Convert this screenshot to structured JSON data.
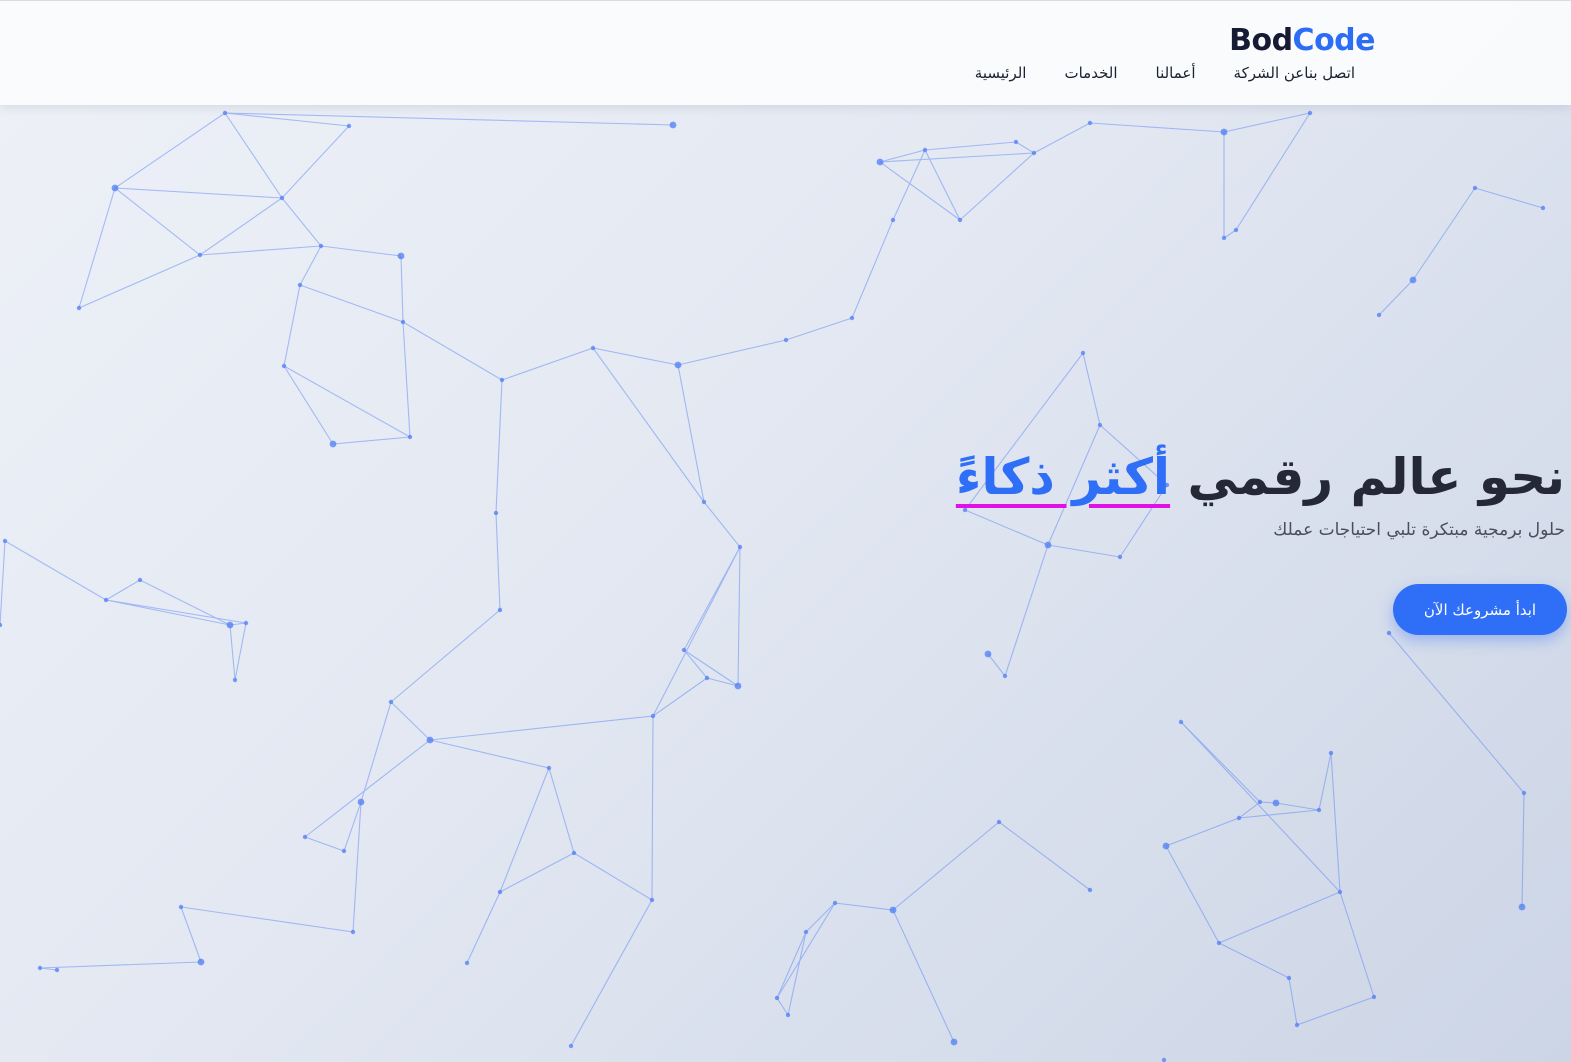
{
  "header": {
    "logo": {
      "part1": "Bod",
      "part2": "Code"
    },
    "nav": [
      {
        "label": "الرئيسية"
      },
      {
        "label": "الخدمات"
      },
      {
        "label": "أعمالنا"
      },
      {
        "label": "عن الشركة"
      },
      {
        "label": "اتصل بنا"
      }
    ]
  },
  "hero": {
    "title_main": "نحو عالم رقمي ",
    "title_accent": "أكثر ذكاءً",
    "subtitle": "حلول برمجية مبتكرة تلبي احتياجات عملك",
    "cta_label": "ابدأ مشروعك الآن"
  },
  "colors": {
    "accent": "#2f6ef6",
    "underline": "#e011e8",
    "text_dark": "#252836",
    "background": "#e3e8f2",
    "network_line": "#4f7df5"
  },
  "icons": {
    "background": "network-graph-icon"
  }
}
